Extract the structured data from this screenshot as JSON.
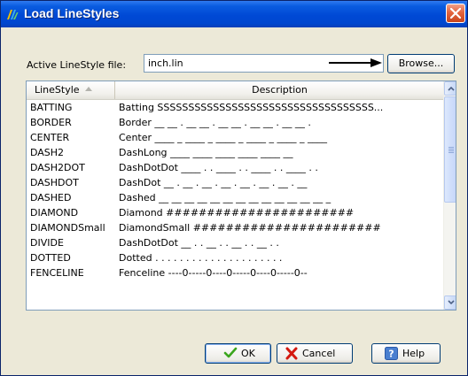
{
  "window": {
    "title": "Load LineStyles"
  },
  "file": {
    "label": "Active LineStyle file:",
    "value": "inch.lin",
    "browse_label": "Browse..."
  },
  "table": {
    "columns": [
      "LineStyle",
      "Description"
    ],
    "rows": [
      {
        "name": "BATTING",
        "desc": "Batting SSSSSSSSSSSSSSSSSSSSSSSSSSSSSSSSSSS..."
      },
      {
        "name": "BORDER",
        "desc": "Border __ __ . __ __ . __ __ . __ __ . __ __ ."
      },
      {
        "name": "CENTER",
        "desc": "Center ____ _ ____ _ ____ _ ____ _ ____ _ ____"
      },
      {
        "name": "DASH2",
        "desc": "DashLong ____   ____   ____   ____   ____   __"
      },
      {
        "name": "DASH2DOT",
        "desc": "DashDotDot ____ . . ____ . . ____ . . ____ . ."
      },
      {
        "name": "DASHDOT",
        "desc": "DashDot __ . __ . __ . __ . __ . __ . __ . __"
      },
      {
        "name": "DASHED",
        "desc": "Dashed __ __ __ __ __ __ __ __ __ __ __ __ __ _"
      },
      {
        "name": "DIAMOND",
        "desc": "Diamond #######################"
      },
      {
        "name": "DIAMONDSmall",
        "desc": "DiamondSmall #######################"
      },
      {
        "name": "DIVIDE",
        "desc": "DashDotDot __ . . __ . . __ . . __ . ."
      },
      {
        "name": "DOTTED",
        "desc": "Dotted . . . . . . . . . . . . . . . . . . . . ."
      },
      {
        "name": "FENCELINE",
        "desc": "Fenceline ----0-----0----0-----0----0-----0--"
      }
    ]
  },
  "buttons": {
    "ok": "OK",
    "cancel": "Cancel",
    "help": "Help"
  },
  "icons": {
    "app": "linestyle-app-icon",
    "close": "close-icon",
    "arrow": "arrow-right-icon",
    "sort": "sort-ascending-icon",
    "ok": "checkmark-icon",
    "cancel": "x-icon",
    "help": "help-icon"
  },
  "colors": {
    "titlebar": "#0049d5",
    "close": "#e4643e",
    "ok_check": "#3aa51d",
    "cancel_x": "#d4190f",
    "help": "#4a7fd0"
  }
}
